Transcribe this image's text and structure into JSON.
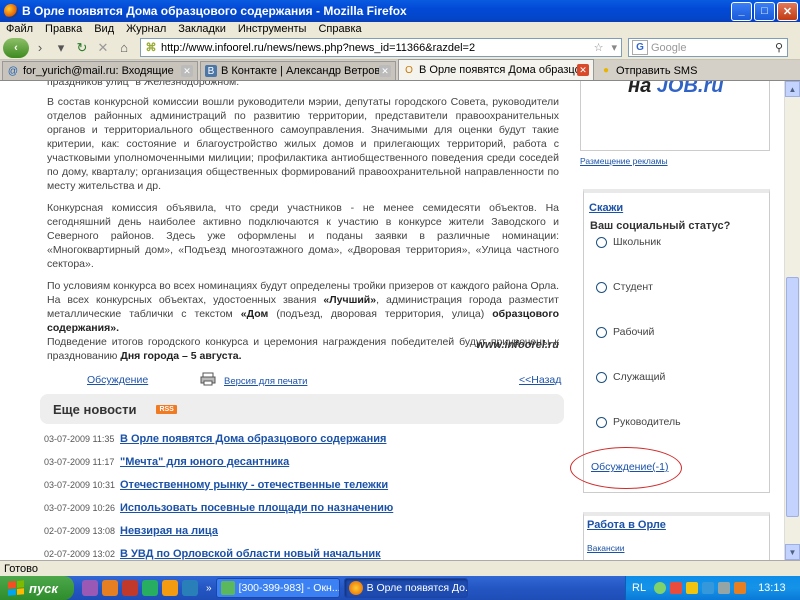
{
  "window": {
    "title": "В Орле появятся Дома образцового содержания - Mozilla Firefox",
    "minimize": "_",
    "maximize": "□",
    "close": "✕"
  },
  "menu": [
    "Файл",
    "Правка",
    "Вид",
    "Журнал",
    "Закладки",
    "Инструменты",
    "Справка"
  ],
  "nav": {
    "url": "http://www.infoorel.ru/news/news.php?news_id=11366&razdel=2",
    "search_placeholder": "Google",
    "search_engine_icon": "G"
  },
  "tabs": [
    {
      "label": "for_yurich@mail.ru: Входящие",
      "icon": "@"
    },
    {
      "label": "В Контакте | Александр Ветров",
      "icon": "B"
    },
    {
      "label": "В Орле появятся Дома образцо...",
      "icon": "O",
      "active": true
    },
    {
      "label": "Отправить SMS",
      "icon": "●"
    }
  ],
  "article": {
    "cutoff": "праздников улиц \"в Железнодорожном.",
    "p1": "В состав конкурсной комиссии вошли руководители мэрии, депутаты городского Совета, руководители отделов районных администраций по развитию территории, представители правоохранительных органов и территориального общественного самоуправления. Значимыми для оценки будут такие критерии, как: состояние и благоустройство жилых домов и прилегающих территорий, работа с участковыми уполномоченными милиции; профилактика антиобщественного поведения среди соседей по дому, кварталу; организация общественных формирований правоохранительной направленности по месту жительства и др.",
    "p2": "Конкурсная комиссия объявила, что среди участников - не менее семидесяти объектов. На сегодняшний день наиболее активно подключаются к участию в конкурсе жители Заводского и Северного районов. Здесь уже оформлены и поданы заявки в различные номинации: «Многоквартирный дом», «Подъезд многоэтажного дома», «Дворовая территория», «Улица частного сектора».",
    "p3_a": "По условиям конкурса во всех номинациях будут определены тройки призеров от каждого района Орла. На всех конкурсных объектах, удостоенных звания ",
    "p3_b": "«Лучший»",
    "p3_c": ", администрация города разместит металлические таблички с текстом ",
    "p3_d": "«Дом",
    "p3_e": " (подъезд, дворовая территория, улица) ",
    "p3_f": "образцового содержания».",
    "p3_g": "Подведение итогов городского конкурса и церемония награждения победителей будут приурочены к празднованию ",
    "p3_h": "Дня города – 5 августа.",
    "source": "www.infoorel.ru"
  },
  "actions": {
    "discuss": "Обсуждение",
    "print": "Версия для печати",
    "back": "<<Назад"
  },
  "more_news": {
    "title": "Еще новости",
    "rss": "RSS",
    "items": [
      {
        "date": "03-07-2009 11:35",
        "title": "В Орле появятся Дома образцового содержания"
      },
      {
        "date": "03-07-2009 11:17",
        "title": "\"Мечта\" для юного десантника"
      },
      {
        "date": "03-07-2009 10:31",
        "title": "Отечественному рынку - отечественные тележки"
      },
      {
        "date": "03-07-2009 10:26",
        "title": "Использовать посевные площади по назначению"
      },
      {
        "date": "02-07-2009 13:08",
        "title": "Невзирая на лица"
      },
      {
        "date": "02-07-2009 13:02",
        "title": "В УВД по Орловской области новый начальник"
      }
    ]
  },
  "sidebar": {
    "ad_text_a": "на ",
    "ad_text_b": "JOB.ru",
    "ad_link": "Размещение рекламы",
    "poll_title": "Скажи",
    "poll_question": "Ваш социальный статус?",
    "poll_options": [
      "Школьник",
      "Студент",
      "Рабочий",
      "Служащий",
      "Руководитель"
    ],
    "poll_discuss": "Обсуждение(-1)",
    "job_title": "Работа в Орле",
    "job_link": "Вакансии"
  },
  "status": "Готово",
  "taskbar": {
    "start": "пуск",
    "windows": [
      {
        "label": "[300-399-983] - Окн...",
        "active": false
      },
      {
        "label": "В Орле появятся До...",
        "active": true
      }
    ],
    "lang": "RL",
    "clock": "13:13"
  },
  "colors": {
    "link": "#1b52a8",
    "highlight_circle": "#d12a2a"
  }
}
